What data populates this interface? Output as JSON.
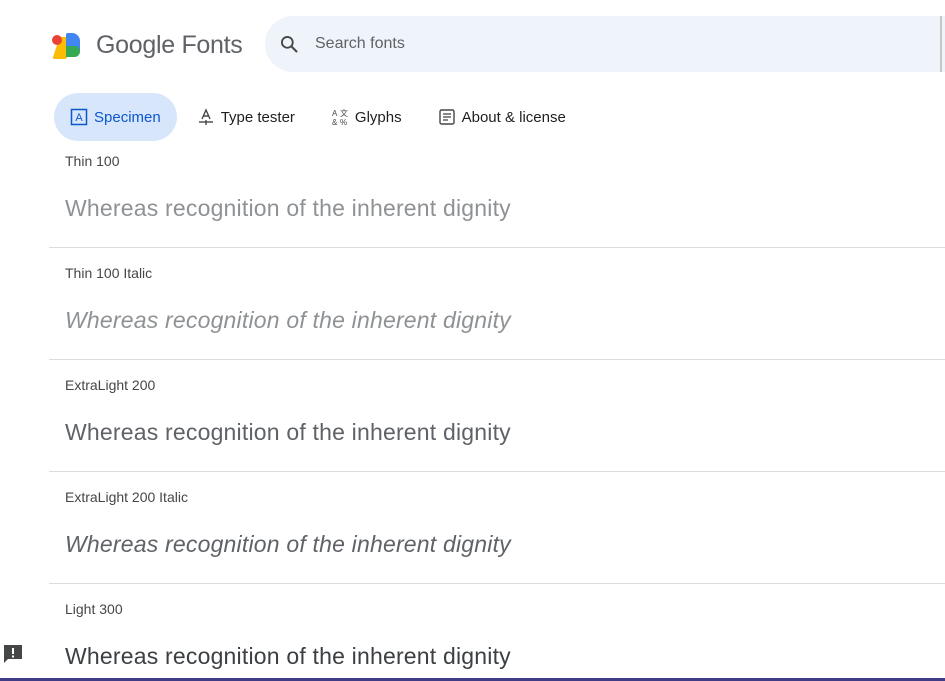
{
  "header": {
    "logo_text": "Google Fonts",
    "search": {
      "placeholder": "Search fonts",
      "icon": "search-icon"
    }
  },
  "tabs": [
    {
      "label": "Specimen",
      "icon": "specimen-icon",
      "active": true
    },
    {
      "label": "Type tester",
      "icon": "type-tester-icon",
      "active": false
    },
    {
      "label": "Glyphs",
      "icon": "glyphs-icon",
      "active": false
    },
    {
      "label": "About & license",
      "icon": "about-license-icon",
      "active": false
    }
  ],
  "styles": [
    {
      "label": "Thin 100",
      "sample": "Whereas recognition of the inherent dignity"
    },
    {
      "label": "Thin 100 Italic",
      "sample": "Whereas recognition of the inherent dignity"
    },
    {
      "label": "ExtraLight 200",
      "sample": "Whereas recognition of the inherent dignity"
    },
    {
      "label": "ExtraLight 200 Italic",
      "sample": "Whereas recognition of the inherent dignity"
    },
    {
      "label": "Light 300",
      "sample": "Whereas recognition of the inherent dignity"
    }
  ],
  "colors": {
    "accent": "#0b57d0",
    "active_tab_bg": "#d8e6fb",
    "search_bg": "#eff3fa",
    "bottom_bar": "#3f3d86"
  },
  "feedback": {
    "icon": "feedback-icon"
  }
}
